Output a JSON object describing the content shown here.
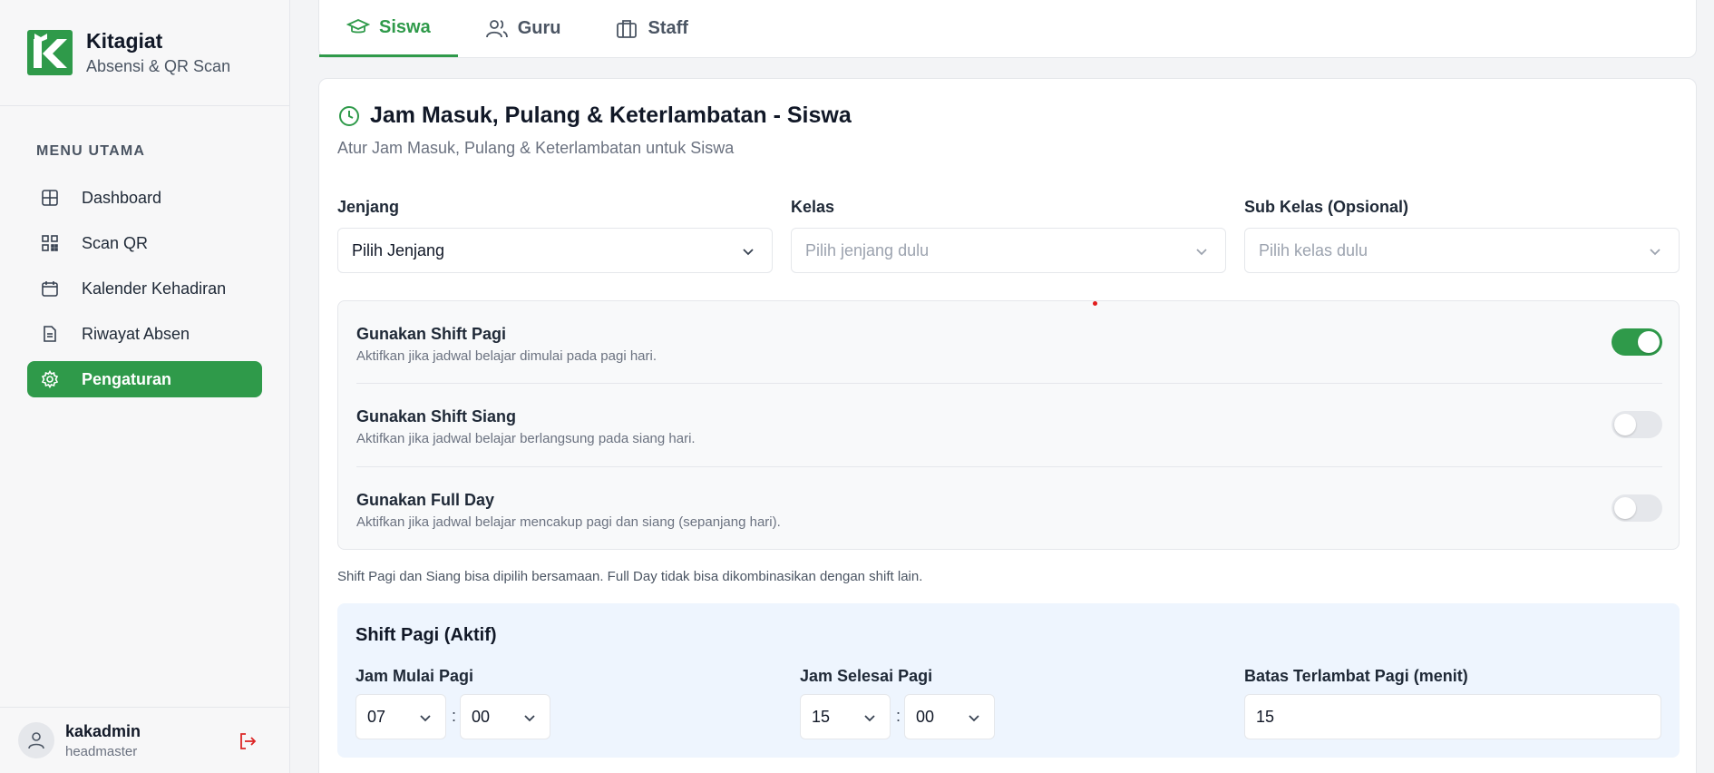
{
  "brand": {
    "name": "Kitagiat",
    "subtitle": "Absensi & QR Scan"
  },
  "sidebar": {
    "menu_title": "MENU UTAMA",
    "items": [
      {
        "label": "Dashboard",
        "icon": "grid-icon"
      },
      {
        "label": "Scan QR",
        "icon": "qr-icon"
      },
      {
        "label": "Kalender Kehadiran",
        "icon": "calendar-icon"
      },
      {
        "label": "Riwayat Absen",
        "icon": "document-icon"
      },
      {
        "label": "Pengaturan",
        "icon": "gear-icon",
        "active": true
      }
    ]
  },
  "user": {
    "name": "kakadmin",
    "role": "headmaster"
  },
  "tabs": [
    {
      "label": "Siswa",
      "icon": "graduation-cap-icon",
      "active": true
    },
    {
      "label": "Guru",
      "icon": "users-icon"
    },
    {
      "label": "Staff",
      "icon": "briefcase-icon"
    }
  ],
  "card": {
    "title": "Jam Masuk, Pulang & Keterlambatan - Siswa",
    "subtitle": "Atur Jam Masuk, Pulang & Keterlambatan untuk Siswa"
  },
  "filters": {
    "jenjang": {
      "label": "Jenjang",
      "value": "Pilih Jenjang"
    },
    "kelas": {
      "label": "Kelas",
      "value": "Pilih jenjang dulu"
    },
    "sub_kelas": {
      "label": "Sub Kelas (Opsional)",
      "value": "Pilih kelas dulu"
    }
  },
  "shifts": [
    {
      "title": "Gunakan Shift Pagi",
      "desc": "Aktifkan jika jadwal belajar dimulai pada pagi hari.",
      "enabled": true
    },
    {
      "title": "Gunakan Shift Siang",
      "desc": "Aktifkan jika jadwal belajar berlangsung pada siang hari.",
      "enabled": false
    },
    {
      "title": "Gunakan Full Day",
      "desc": "Aktifkan jika jadwal belajar mencakup pagi dan siang (sepanjang hari).",
      "enabled": false
    }
  ],
  "note": "Shift Pagi dan Siang bisa dipilih bersamaan. Full Day tidak bisa dikombinasikan dengan shift lain.",
  "active_shift": {
    "title": "Shift Pagi (Aktif)",
    "start_label": "Jam Mulai Pagi",
    "start_hour": "07",
    "start_minute": "00",
    "end_label": "Jam Selesai Pagi",
    "end_hour": "15",
    "end_minute": "00",
    "late_label": "Batas Terlambat Pagi (menit)",
    "late_value": "15",
    "separator": ":"
  },
  "colors": {
    "accent": "#2f9a4a",
    "panel_blue": "#eef5fe",
    "logout": "#dc2626"
  }
}
